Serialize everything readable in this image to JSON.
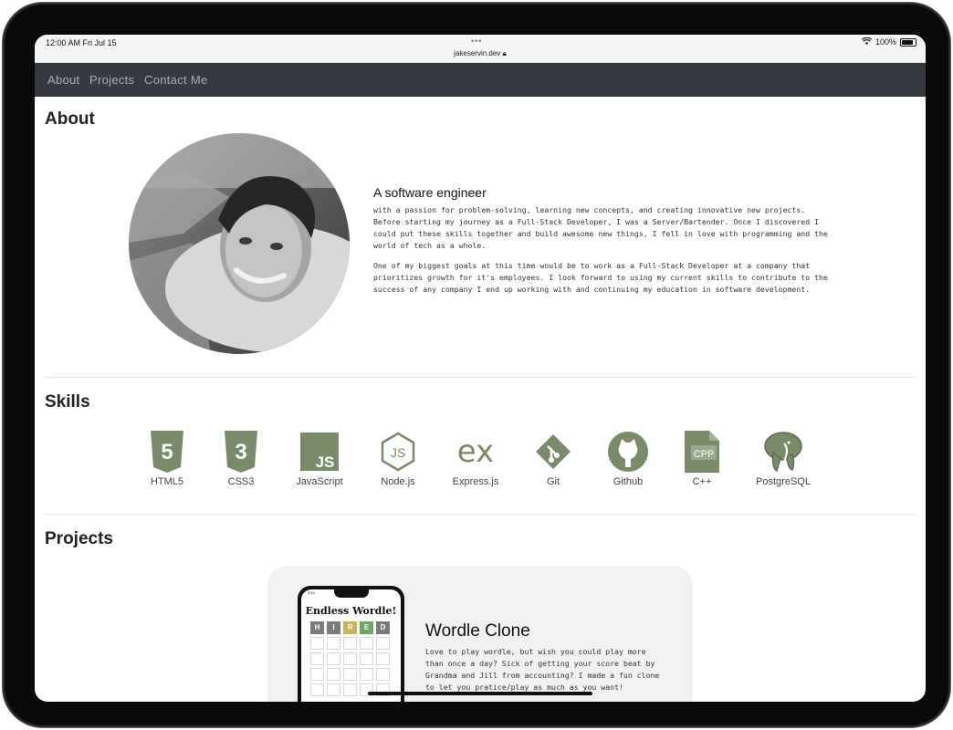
{
  "status_bar": {
    "time": "12:00 AM  Fri Jul 15",
    "url": "jakeservin.dev",
    "battery": "100%"
  },
  "nav": {
    "links": [
      "About",
      "Projects",
      "Contact Me"
    ]
  },
  "about": {
    "heading": "About",
    "subtitle": "A software engineer",
    "paragraph1": "with a passion for problem-solving, learning new concepts, and creating innovative new projects. Before starting my journey as a Full-Stack Developer, I was a Server/Bartender. Once I discovered I could put these skills together and build awesome new things, I fell in love with programming and the world of tech as a whole.",
    "paragraph2": "One of my biggest goals at this time would be to work as a Full-Stack Developer at a company that prioritizes growth for it's employees. I look forward to using my current skills to contribute to the success of any company I end up working with and continuing my education in software development."
  },
  "skills": {
    "heading": "Skills",
    "icon_color": "#7a8b6a",
    "items": [
      {
        "label": "HTML5",
        "icon": "html5-icon",
        "badge": "5"
      },
      {
        "label": "CSS3",
        "icon": "css3-icon",
        "badge": "3"
      },
      {
        "label": "JavaScript",
        "icon": "javascript-icon",
        "badge": "JS"
      },
      {
        "label": "Node.js",
        "icon": "nodejs-icon",
        "badge": "JS"
      },
      {
        "label": "Express.js",
        "icon": "express-icon",
        "badge": "ex"
      },
      {
        "label": "Git",
        "icon": "git-icon",
        "badge": ""
      },
      {
        "label": "Github",
        "icon": "github-icon",
        "badge": ""
      },
      {
        "label": "C++",
        "icon": "cpp-icon",
        "badge": "CPP"
      },
      {
        "label": "PostgreSQL",
        "icon": "postgresql-icon",
        "badge": ""
      }
    ]
  },
  "projects": {
    "heading": "Projects",
    "items": [
      {
        "title": "Wordle Clone",
        "description": "Love to play wordle, but wish you could play more than once a day? Sick of getting your score beat by Grandma and Jill from accounting? I made a fun clone to let you pratice/play as much as you want!",
        "preview": {
          "time": "9:16",
          "title": "Endless Wordle!",
          "letters": [
            "H",
            "I",
            "R",
            "E",
            "D"
          ],
          "tile_colors": [
            "#787c7e",
            "#787c7e",
            "#c9b458",
            "#6aaa64",
            "#787c7e"
          ]
        }
      }
    ]
  }
}
